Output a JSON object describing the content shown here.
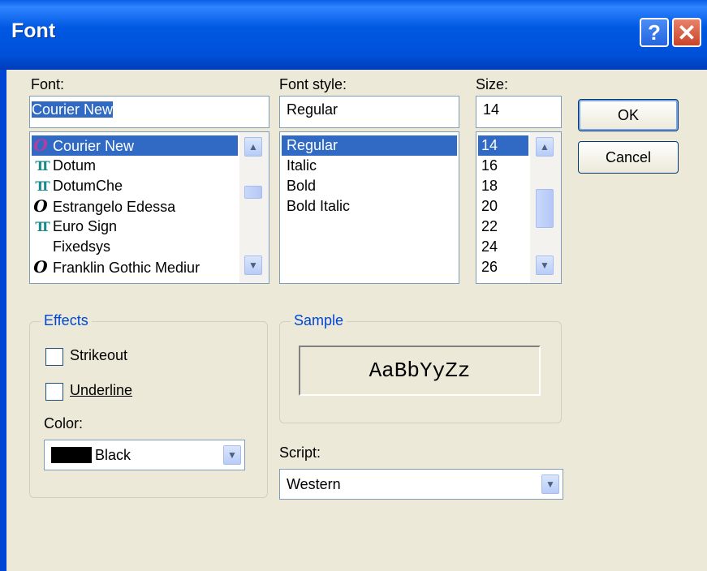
{
  "window": {
    "title": "Font"
  },
  "font": {
    "label": "Font:",
    "value": "Courier New",
    "items": [
      {
        "icon": "o",
        "label": "Courier New",
        "selected": true
      },
      {
        "icon": "tt",
        "label": "Dotum"
      },
      {
        "icon": "tt",
        "label": "DotumChe"
      },
      {
        "icon": "o",
        "label": "Estrangelo Edessa"
      },
      {
        "icon": "tt",
        "label": "Euro Sign"
      },
      {
        "icon": "",
        "label": "Fixedsys"
      },
      {
        "icon": "o",
        "label": "Franklin Gothic Mediur"
      }
    ]
  },
  "style": {
    "label": "Font style:",
    "value": "Regular",
    "items": [
      "Regular",
      "Italic",
      "Bold",
      "Bold Italic"
    ]
  },
  "size": {
    "label": "Size:",
    "value": "14",
    "items": [
      "14",
      "16",
      "18",
      "20",
      "22",
      "24",
      "26"
    ]
  },
  "buttons": {
    "ok": "OK",
    "cancel": "Cancel"
  },
  "effects": {
    "legend": "Effects",
    "strikeout": "Strikeout",
    "underline": "Underline",
    "color_label": "Color:",
    "color_value": "Black",
    "color_swatch": "#000000"
  },
  "sample": {
    "legend": "Sample",
    "text": "AaBbYyZz"
  },
  "script": {
    "label": "Script:",
    "value": "Western"
  },
  "colors": {
    "titlebar": "#0054e3",
    "selection": "#316ac5",
    "dialog_bg": "#ece9d8",
    "group_title": "#0046d5"
  }
}
